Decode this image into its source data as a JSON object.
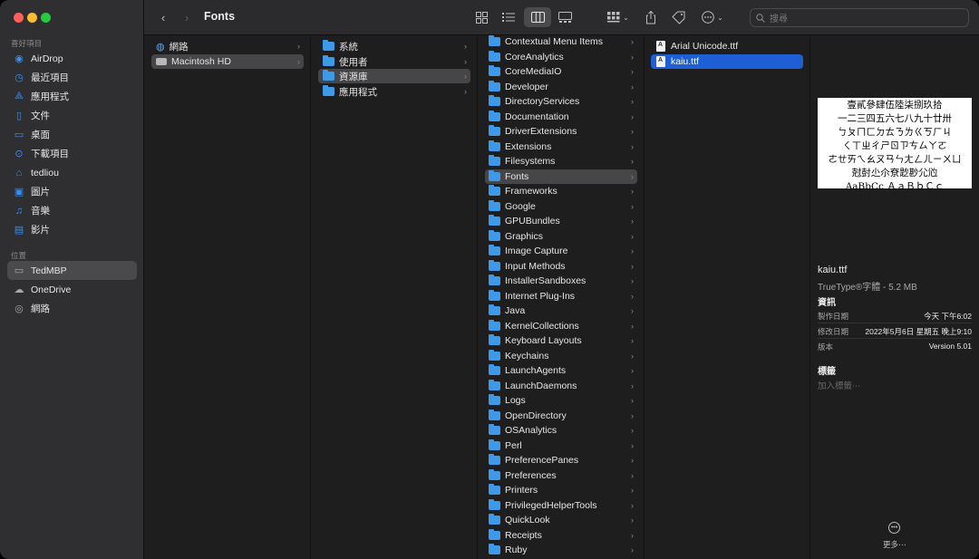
{
  "window": {
    "title": "Fonts"
  },
  "sidebar": {
    "favorites_label": "喜好項目",
    "favorites": [
      {
        "label": "AirDrop",
        "icon": "airdrop-icon"
      },
      {
        "label": "最近項目",
        "icon": "clock-icon"
      },
      {
        "label": "應用程式",
        "icon": "applications-icon"
      },
      {
        "label": "文件",
        "icon": "document-icon"
      },
      {
        "label": "桌面",
        "icon": "desktop-icon"
      },
      {
        "label": "下載項目",
        "icon": "download-icon"
      },
      {
        "label": "tedliou",
        "icon": "home-icon"
      },
      {
        "label": "圖片",
        "icon": "pictures-icon"
      },
      {
        "label": "音樂",
        "icon": "music-icon"
      },
      {
        "label": "影片",
        "icon": "movies-icon"
      }
    ],
    "locations_label": "位置",
    "locations": [
      {
        "label": "TedMBP",
        "icon": "laptop-icon"
      },
      {
        "label": "OneDrive",
        "icon": "cloud-icon"
      },
      {
        "label": "網路",
        "icon": "network-icon"
      }
    ]
  },
  "toolbar": {
    "title": "Fonts",
    "search_placeholder": "搜尋"
  },
  "columns": {
    "col1": [
      {
        "label": "網路",
        "kind": "network"
      },
      {
        "label": "Macintosh HD",
        "kind": "disk"
      }
    ],
    "col2": [
      "系統",
      "使用者",
      "資源庫",
      "應用程式"
    ],
    "col3": [
      "Contextual Menu Items",
      "CoreAnalytics",
      "CoreMediaIO",
      "Developer",
      "DirectoryServices",
      "Documentation",
      "DriverExtensions",
      "Extensions",
      "Filesystems",
      "Fonts",
      "Frameworks",
      "Google",
      "GPUBundles",
      "Graphics",
      "Image Capture",
      "Input Methods",
      "InstallerSandboxes",
      "Internet Plug-Ins",
      "Java",
      "KernelCollections",
      "Keyboard Layouts",
      "Keychains",
      "LaunchAgents",
      "LaunchDaemons",
      "Logs",
      "OpenDirectory",
      "OSAnalytics",
      "Perl",
      "PreferencePanes",
      "Preferences",
      "Printers",
      "PrivilegedHelperTools",
      "QuickLook",
      "Receipts",
      "Ruby"
    ],
    "col4": [
      "Arial Unicode.ttf",
      "kaiu.ttf"
    ]
  },
  "preview": {
    "sample_lines": [
      "壹貳參肆伍陸柒捌玖拾",
      "一二三四五六七八九十廿卅",
      "ㄅㄆㄇㄈㄉㄊㄋㄌㄍㄎㄏㄐ",
      "ㄑㄒㄓㄔㄕㄖㄗㄘㄙㄚㄛ",
      "ㄜㄝㄞㄟㄠㄡㄢㄣㄤㄥㄦㄧㄨㄩ",
      "尅尌尐尒尞尟尠尣尦",
      "AaBbCc ＡａＢｂＣｃ"
    ],
    "file_name": "kaiu.ttf",
    "file_kind": "TrueType®字體 - 5.2 MB",
    "info_heading": "資訊",
    "created_label": "製作日期",
    "created_value": "今天 下午6:02",
    "modified_label": "修改日期",
    "modified_value": "2022年5月6日 星期五 晚上9:10",
    "version_label": "版本",
    "version_value": "Version 5.01",
    "tags_heading": "標籤",
    "tags_placeholder": "加入標籤⋯",
    "more_label": "更多⋯"
  }
}
